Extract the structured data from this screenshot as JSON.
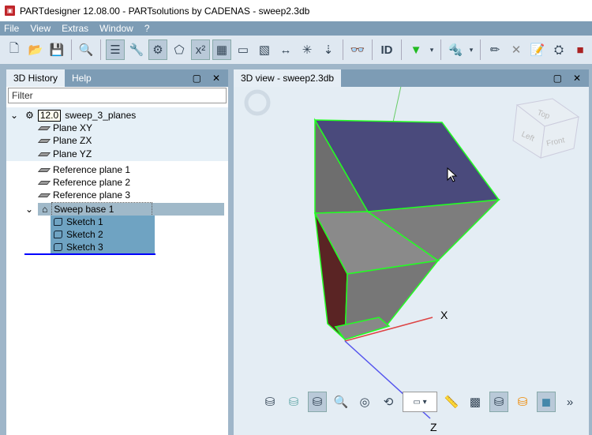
{
  "window": {
    "title": "PARTdesigner 12.08.00 - PARTsolutions by CADENAS - sweep2.3db"
  },
  "menu": [
    "File",
    "View",
    "Extras",
    "Window",
    "?"
  ],
  "left_panel": {
    "tabs": [
      "3D History",
      "Help"
    ],
    "filter_placeholder": "Filter",
    "tree": {
      "version": "12.0",
      "root": "sweep_3_planes",
      "base_planes": [
        "Plane XY",
        "Plane ZX",
        "Plane YZ"
      ],
      "ref_planes": [
        "Reference plane 1",
        "Reference plane 2",
        "Reference plane 3"
      ],
      "sweep": "Sweep base 1",
      "sketches": [
        "Sketch 1",
        "Sketch 2",
        "Sketch 3"
      ]
    }
  },
  "view_panel": {
    "tab": "3D view - sweep2.3db",
    "cube": {
      "top": "Top",
      "left": "Left",
      "front": "Front"
    },
    "axes": {
      "x": "X",
      "z": "Z"
    },
    "more": "»"
  }
}
